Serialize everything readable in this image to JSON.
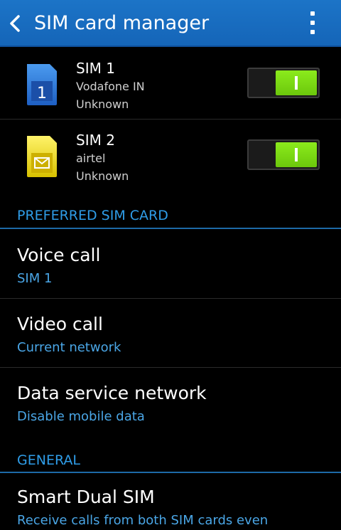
{
  "header": {
    "title": "SIM card manager",
    "back_icon": "chevron-left-icon",
    "menu_icon": "more-vertical-icon",
    "background_color": "#1a6fc4"
  },
  "sims": [
    {
      "name": "SIM 1",
      "carrier": "Vodafone IN",
      "status": "Unknown",
      "icon": "sim-card-blue-icon",
      "icon_label": "1",
      "enabled": true
    },
    {
      "name": "SIM 2",
      "carrier": "airtel",
      "status": "Unknown",
      "icon": "sim-card-yellow-envelope-icon",
      "enabled": true
    }
  ],
  "preferred": {
    "header": "PREFERRED SIM CARD",
    "items": [
      {
        "title": "Voice call",
        "value": "SIM 1"
      },
      {
        "title": "Video call",
        "value": "Current network"
      },
      {
        "title": "Data service network",
        "value": "Disable mobile data"
      }
    ]
  },
  "general": {
    "header": "GENERAL",
    "items": [
      {
        "title": "Smart Dual SIM",
        "value": "Receive calls from both SIM cards even"
      }
    ]
  },
  "colors": {
    "accent": "#2f9de8",
    "toggle_on": "#7ed813"
  }
}
